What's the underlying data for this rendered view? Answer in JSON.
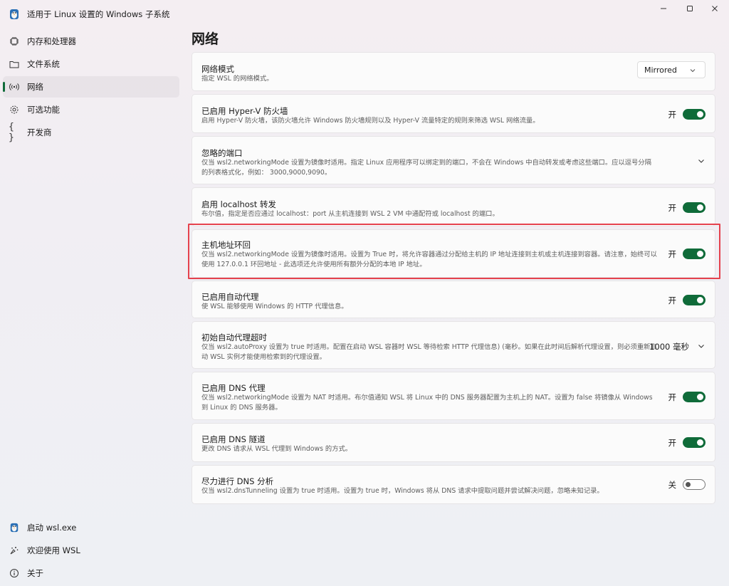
{
  "window": {
    "title": "适用于 Linux 设置的 Windows 子系统",
    "icon": "wsl-penguin-icon",
    "controls": {
      "minimize": "–",
      "maximize": "☐",
      "close": "✕"
    }
  },
  "sidebar": {
    "items": [
      {
        "label": "内存和处理器",
        "icon": "memory-chip-icon",
        "selected": false
      },
      {
        "label": "文件系统",
        "icon": "folder-icon",
        "selected": false
      },
      {
        "label": "网络",
        "icon": "network-antenna-icon",
        "selected": true
      },
      {
        "label": "可选功能",
        "icon": "gear-icon",
        "selected": false
      },
      {
        "label": "开发商",
        "icon": "braces-icon",
        "selected": false
      }
    ],
    "footer": [
      {
        "label": "启动 wsl.exe",
        "icon": "wsl-penguin-icon"
      },
      {
        "label": "欢迎使用 WSL",
        "icon": "welcome-sparkle-icon"
      },
      {
        "label": "关于",
        "icon": "info-icon"
      }
    ]
  },
  "main": {
    "title": "网络",
    "settings": [
      {
        "title": "网络模式",
        "desc": "指定 WSL 的网络模式。",
        "control": "dropdown",
        "value": "Mirrored"
      },
      {
        "title": "已启用 Hyper-V 防火墙",
        "desc": "启用 Hyper-V 防火墙，该防火墙允许 Windows 防火墙规则以及 Hyper-V 流量特定的规则来筛选 WSL 网络流量。",
        "control": "toggle",
        "state": "开",
        "on": true
      },
      {
        "title": "忽略的端口",
        "desc": "仅当 wsl2.networkingMode 设置为镜像时适用。指定 Linux 应用程序可以绑定到的端口，不会在 Windows 中自动转发或考虑这些端口。应以逗号分隔的列表格式化，例如： 3000,9000,9090。",
        "control": "expand"
      },
      {
        "title": "启用 localhost 转发",
        "desc": "布尔值，指定是否应通过 localhost：port 从主机连接到 WSL 2 VM 中通配符或 localhost 的端口。",
        "control": "toggle",
        "state": "开",
        "on": true
      },
      {
        "title": "主机地址环回",
        "desc": "仅当 wsl2.networkingMode 设置为镜像时适用。设置为 True 时，将允许容器通过分配给主机的 IP 地址连接到主机或主机连接到容器。请注意，始终可以使用 127.0.0.1 环回地址 - 此选项还允许使用所有额外分配的本地 IP 地址。",
        "control": "toggle",
        "state": "开",
        "on": true
      },
      {
        "title": "已启用自动代理",
        "desc": "使 WSL 能够使用 Windows 的 HTTP 代理信息。",
        "control": "toggle",
        "state": "开",
        "on": true
      },
      {
        "title": "初始自动代理超时",
        "desc": "仅当 wsl2.autoProxy 设置为 true 时适用。配置在启动 WSL 容器时 WSL 等待检索 HTTP 代理信息) (毫秒。如果在此时间后解析代理设置，则必须重新启动 WSL 实例才能使用检索到的代理设置。",
        "control": "expand-value",
        "value": "1000 毫秒"
      },
      {
        "title": "已启用 DNS 代理",
        "desc": "仅当 wsl2.networkingMode 设置为 NAT 时适用。布尔值通知 WSL 将 Linux 中的 DNS 服务器配置为主机上的 NAT。设置为 false 将镜像从 Windows 到 Linux 的 DNS 服务器。",
        "control": "toggle",
        "state": "开",
        "on": true
      },
      {
        "title": "已启用 DNS 隧道",
        "desc": "更改 DNS 请求从 WSL 代理到 Windows 的方式。",
        "control": "toggle",
        "state": "开",
        "on": true
      },
      {
        "title": "尽力进行 DNS 分析",
        "desc": "仅当 wsl2.dnsTunneling 设置为 true 时适用。设置为 true 时，Windows 将从 DNS 请求中提取问题并尝试解决问题，忽略未知记录。",
        "control": "toggle",
        "state": "关",
        "on": false
      }
    ]
  },
  "colors": {
    "accent": "#0f6b39",
    "highlight": "#e5424d"
  }
}
